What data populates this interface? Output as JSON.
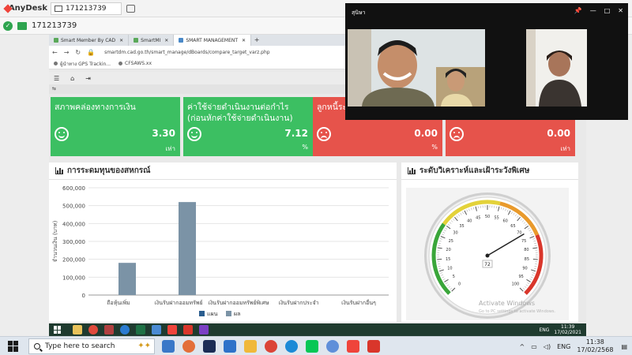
{
  "anydesk": {
    "app_name": "AnyDesk",
    "tab_id": "171213739",
    "address_id": "171213739"
  },
  "browser": {
    "tabs": [
      {
        "label": "Smart Member By CAD"
      },
      {
        "label": "SmartMI"
      },
      {
        "label": "SMART MANAGEMENT"
      }
    ],
    "url": "smartdm.cad.go.th/smart_manage/dBoards/compare_target_varz.php",
    "bookmarks": [
      "ผู้นำทาง GPS Trackin...",
      "CFSAWS.xx"
    ]
  },
  "video_window": {
    "title": "สุนิษา",
    "controls": [
      "📌",
      "—",
      "□",
      "✕"
    ]
  },
  "kpi_cards": [
    {
      "title": "สภาพคล่องทางการเงิน",
      "value": "3.30",
      "unit": "เท่า",
      "status": "good",
      "color": "#3cbf62"
    },
    {
      "title": "ค่าใช้จ่ายดำเนินงานต่อกำไร (ก่อนหักค่าใช้จ่ายดำเนินงาน)",
      "value": "7.12",
      "unit": "%",
      "status": "good",
      "color": "#3cbf62"
    },
    {
      "title": "ลูกหนี้ระ",
      "value": "0.00",
      "unit": "%",
      "status": "bad",
      "color": "#e6534b"
    },
    {
      "title": "",
      "value": "0.00",
      "unit": "เท่า",
      "status": "bad",
      "color": "#e6534b"
    }
  ],
  "capital_panel": {
    "title": "การระดมทุนของสหกรณ์"
  },
  "risk_panel": {
    "title": "ระดับวิเคราะห์และเฝ้าระวังพิเศษ"
  },
  "gauge": {
    "value": 72,
    "min": 0,
    "max": 100,
    "ticks": [
      0,
      5,
      10,
      15,
      20,
      25,
      30,
      35,
      40,
      45,
      50,
      55,
      60,
      65,
      70,
      75,
      80,
      85,
      90,
      95,
      100
    ],
    "value_label": "72",
    "zones": [
      {
        "from": 0,
        "to": 30,
        "color": "#3aa63a"
      },
      {
        "from": 30,
        "to": 55,
        "color": "#e3d23a"
      },
      {
        "from": 55,
        "to": 75,
        "color": "#e99a2c"
      },
      {
        "from": 75,
        "to": 100,
        "color": "#d9362b"
      }
    ]
  },
  "chart_data": {
    "type": "bar",
    "categories": [
      "ถือหุ้นเพิ่ม",
      "เงินรับฝากออมทรัพย์",
      "เงินรับฝากออมทรัพย์พิเศษ",
      "เงินรับฝากประจำ",
      "เงินรับฝากอื่นๆ"
    ],
    "series": [
      {
        "name": "แผน",
        "color": "#2a5d8f",
        "values": [
          0,
          0,
          0,
          0,
          0
        ]
      },
      {
        "name": "ผล",
        "color": "#7b93a6",
        "values": [
          180000,
          520000,
          0,
          0,
          0
        ]
      }
    ],
    "ylabel": "จำนวนเงิน (บาท)",
    "ylim": [
      0,
      600000
    ],
    "yticks": [
      "600,000",
      "500,000",
      "400,000",
      "300,000",
      "200,000",
      "100,000",
      "0"
    ],
    "grid": true,
    "legend": "bottom"
  },
  "watermark": {
    "line1": "Activate Windows",
    "line2": "Go to PC settings to activate Windows."
  },
  "remote_taskbar": {
    "lang": "ENG",
    "time": "11:39",
    "date": "17/02/2021"
  },
  "taskbar": {
    "search_placeholder": "Type here to search",
    "lang": "ENG",
    "time": "11:38",
    "date": "17/02/2568"
  }
}
